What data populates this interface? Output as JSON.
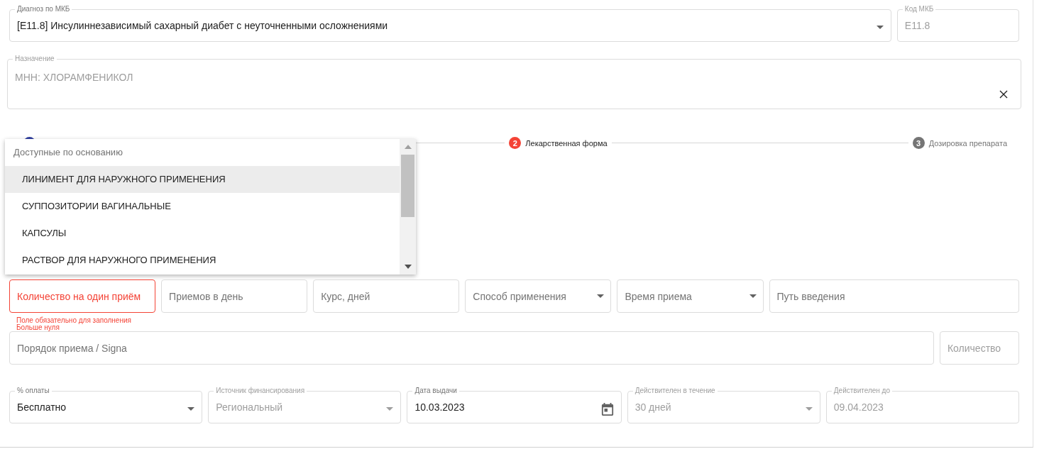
{
  "rows": [
    [
      {
        "kind": "select",
        "label": "Диагноз по МКБ",
        "value": "[E11.8] Инсулиннезависимый сахарный диабет с неуточненными осложнениями",
        "disabled": false,
        "invalid": false
      },
      {
        "kind": "text",
        "label": "Код МКБ",
        "value": "E11.8",
        "disabled": true,
        "invalid": false
      }
    ],
    [
      {
        "kind": "clearable",
        "label": "Назначение",
        "value": "МНН: ХЛОРАМФЕНИКОЛ",
        "disabled": true,
        "invalid": false
      }
    ]
  ],
  "stepper": {
    "steps": [
      {
        "completed": true,
        "error": false
      },
      {
        "completed": false,
        "error": true,
        "number": "2",
        "label": "Лекарственная форма"
      },
      {
        "completed": false,
        "error": false,
        "number": "3",
        "label": "Дозировка препарата"
      }
    ]
  },
  "dropdown": {
    "header": "Доступные по основанию",
    "items": [
      {
        "label": "ЛИНИМЕНТ ДЛЯ НАРУЖНОГО ПРИМЕНЕНИЯ",
        "selected": true
      },
      {
        "label": "СУППОЗИТОРИИ ВАГИНАЛЬНЫЕ",
        "selected": false
      },
      {
        "label": "КАПСУЛЫ",
        "selected": false
      },
      {
        "label": "РАСТВОР ДЛЯ НАРУЖНОГО ПРИМЕНЕНИЯ",
        "selected": false
      }
    ]
  },
  "dosage_row": [
    {
      "kind": "text",
      "placeholder": "Количество на один приём",
      "disabled": false,
      "invalid": true
    },
    {
      "kind": "text",
      "placeholder": "Приемов в день",
      "disabled": false,
      "invalid": false
    },
    {
      "kind": "text",
      "placeholder": "Курс, дней",
      "disabled": false,
      "invalid": false
    },
    {
      "kind": "select",
      "placeholder": "Способ применения",
      "disabled": false,
      "invalid": false
    },
    {
      "kind": "select",
      "placeholder": "Время приема",
      "disabled": false,
      "invalid": false
    },
    {
      "kind": "text",
      "placeholder": "Путь введения",
      "disabled": false,
      "invalid": false
    }
  ],
  "dosage_errors": [
    "Поле обязательно для заполнения",
    "Больше нуля"
  ],
  "signa_row": [
    {
      "kind": "text",
      "placeholder": "Порядок приема / Signa",
      "disabled": false,
      "invalid": false
    },
    {
      "kind": "text",
      "placeholder": "Количество",
      "disabled": true,
      "invalid": false
    }
  ],
  "payment_row": [
    {
      "kind": "select",
      "label": "% оплаты",
      "value": "Бесплатно",
      "disabled": false,
      "invalid": false
    },
    {
      "kind": "select",
      "label": "Источник финансирования",
      "value": "Региональный",
      "disabled": true,
      "invalid": false
    },
    {
      "kind": "date",
      "label": "Дата выдачи",
      "value": "10.03.2023",
      "disabled": false,
      "invalid": false
    },
    {
      "kind": "select",
      "label": "Действителен в течение",
      "value": "30 дней",
      "disabled": true,
      "invalid": false
    },
    {
      "kind": "text",
      "label": "Действителен до",
      "value": "09.04.2023",
      "disabled": true,
      "invalid": false
    }
  ]
}
